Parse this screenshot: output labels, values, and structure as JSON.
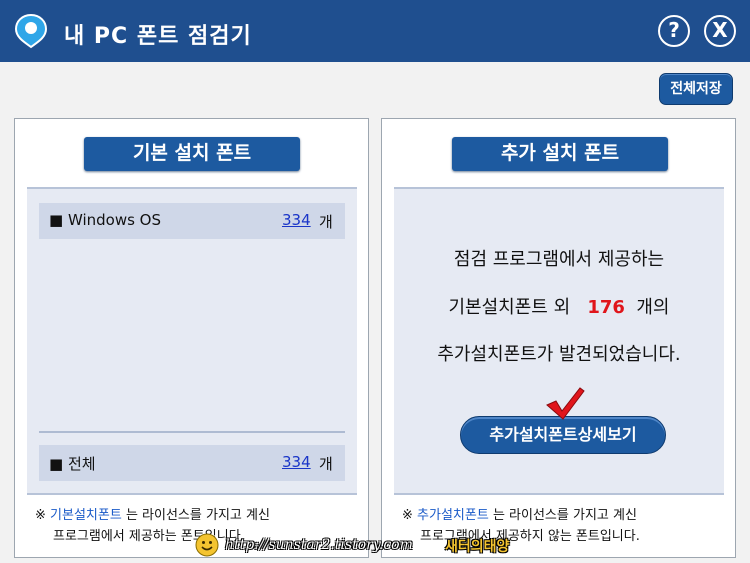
{
  "window": {
    "title": "내 PC 폰트 점검기",
    "help_label": "?",
    "close_label": "X"
  },
  "toolbar": {
    "save_all_label": "전체저장"
  },
  "left_panel": {
    "header": "기본 설치 폰트",
    "rows": [
      {
        "label": "■ Windows OS",
        "count": "334",
        "unit": "개"
      },
      {
        "label": "■ 전체",
        "count": "334",
        "unit": "개"
      }
    ],
    "footnote_prefix": "※",
    "footnote_link": "기본설치폰트",
    "footnote_rest": "는 라이선스를 가지고 계신",
    "footnote_line2": "프로그램에서 제공하는 폰트입니다."
  },
  "right_panel": {
    "header": "추가 설치 폰트",
    "message_line1": "점검 프로그램에서 제공하는",
    "message_line2_prefix": "기본설치폰트 외",
    "message_count": "176",
    "message_line2_suffix": "개의",
    "message_line3": "추가설치폰트가 발견되었습니다.",
    "detail_button_label": "추가설치폰트상세보기",
    "footnote_prefix": "※",
    "footnote_link": "추가설치폰트",
    "footnote_rest": "는 라이선스를 가지고 계신",
    "footnote_line2": "프로그램에서 제공하지 않는 폰트입니다."
  },
  "watermark": {
    "url": "http://sunstar2.tistory.com",
    "name": "새터의태양"
  },
  "icons": {
    "app": "location-pin-icon",
    "help": "help-icon",
    "close": "close-icon",
    "check": "check-mark-icon",
    "watermark": "smiley-icon"
  },
  "colors": {
    "titlebar": "#1f4f8f",
    "button": "#1d5aa0",
    "link": "#1a35c8",
    "count_highlight": "#e0151b",
    "check_mark": "#e0151b"
  }
}
